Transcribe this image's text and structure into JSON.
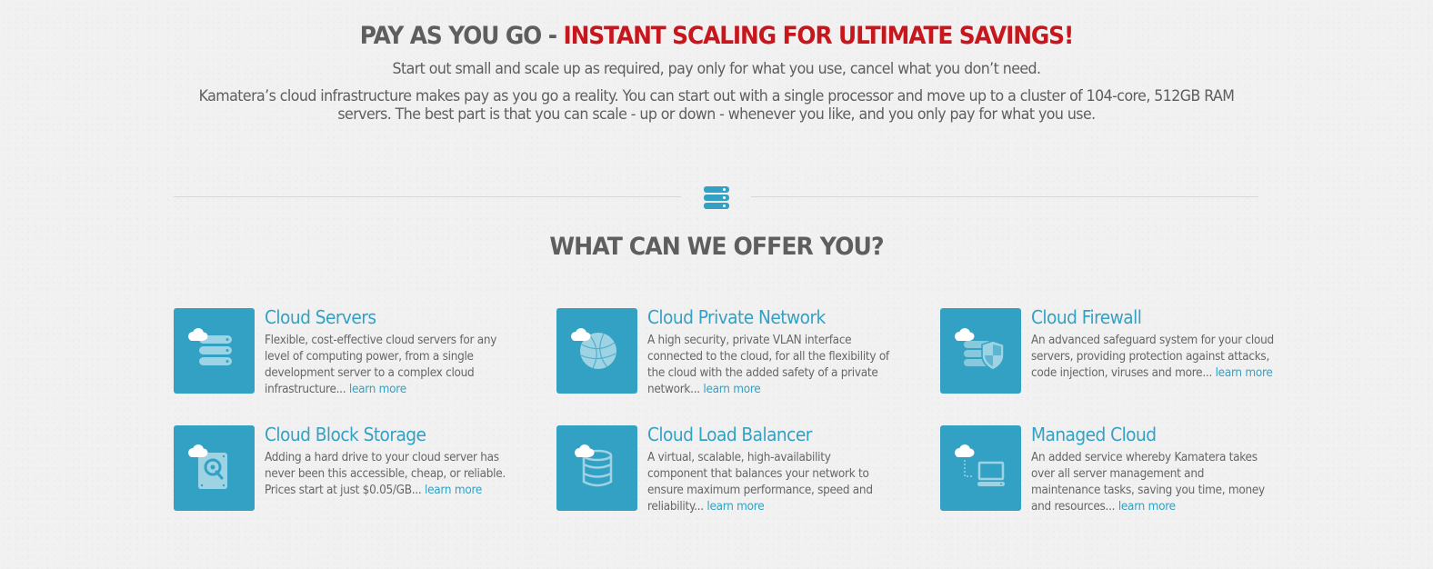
{
  "hero": {
    "title_plain": "PAY AS YOU GO - ",
    "title_accent": "INSTANT SCALING FOR ULTIMATE SAVINGS!",
    "subtitle": "Start out small and scale up as required, pay only for what you use, cancel what you don’t need.",
    "body": "Kamatera’s cloud infrastructure makes pay as you go a reality. You can start out with a single processor and move up to a cluster of 104-core, 512GB RAM servers. The best part is that you can scale - up or down - whenever you like, and you only pay for what you use."
  },
  "divider": {
    "icon": "server-stack-icon"
  },
  "offer": {
    "title": "WHAT CAN WE OFFER YOU?"
  },
  "colors": {
    "accent": "#33a1c4",
    "highlight": "#c8161d",
    "text": "#5e5e5e"
  },
  "services": [
    {
      "name": "Cloud Servers",
      "description": "Flexible, cost-effective cloud servers for any level of computing power, from a single development server to a complex cloud infrastructure... ",
      "link": "learn more",
      "icon": "cloud-servers-icon"
    },
    {
      "name": "Cloud Private Network",
      "description": "A high security, private VLAN interface connected to the cloud, for all the flexibility of the cloud with the added safety of a private network... ",
      "link": "learn more",
      "icon": "cloud-network-globe-icon"
    },
    {
      "name": "Cloud Firewall",
      "description": "An advanced safeguard system for your cloud servers, providing protection against attacks, code injection, viruses and more... ",
      "link": "learn more",
      "icon": "cloud-firewall-shield-icon"
    },
    {
      "name": "Cloud Block Storage",
      "description": "Adding a hard drive to your cloud server has never been this accessible, cheap, or reliable. Prices start at just $0.05/GB... ",
      "link": "learn more",
      "icon": "cloud-hard-drive-icon"
    },
    {
      "name": "Cloud Load Balancer",
      "description": "A virtual, scalable, high-availability component that balances your network to ensure maximum performance, speed and reliability... ",
      "link": "learn more",
      "icon": "cloud-database-icon"
    },
    {
      "name": "Managed Cloud",
      "description": "An added service whereby Kamatera takes over all server management and maintenance tasks, saving you time, money and resources... ",
      "link": "learn more",
      "icon": "cloud-managed-computer-icon"
    }
  ]
}
